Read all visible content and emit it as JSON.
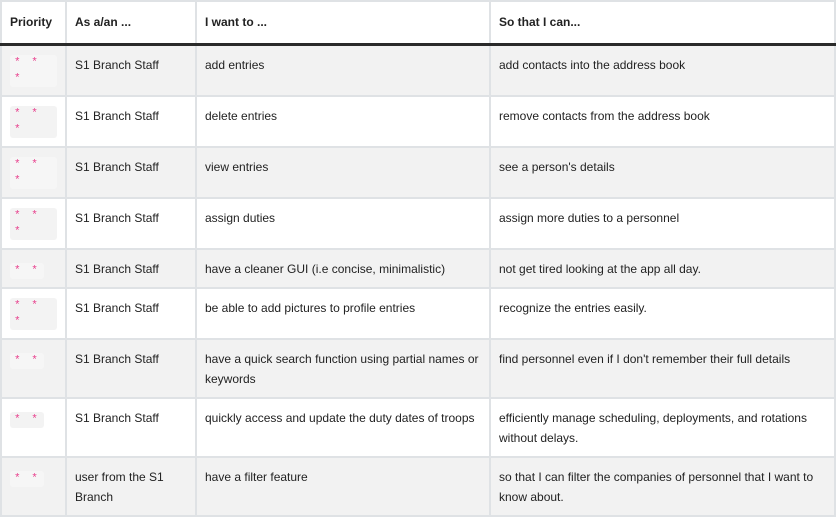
{
  "headers": [
    "Priority",
    "As a/an ...",
    "I want to ...",
    "So that I can..."
  ],
  "rows": [
    {
      "priority": "* * *",
      "role": "S1 Branch Staff",
      "want": "add entries",
      "benefit": "add contacts into the address book"
    },
    {
      "priority": "* * *",
      "role": "S1 Branch Staff",
      "want": "delete entries",
      "benefit": "remove contacts from the address book"
    },
    {
      "priority": "* * *",
      "role": "S1 Branch Staff",
      "want": "view entries",
      "benefit": "see a person's details"
    },
    {
      "priority": "* * *",
      "role": "S1 Branch Staff",
      "want": "assign duties",
      "benefit": "assign more duties to a personnel"
    },
    {
      "priority": "* *",
      "role": "S1 Branch Staff",
      "want": "have a cleaner GUI (i.e concise, minimalistic)",
      "benefit": "not get tired looking at the app all day."
    },
    {
      "priority": "* * *",
      "role": "S1 Branch Staff",
      "want": "be able to add pictures to profile entries",
      "benefit": "recognize the entries easily."
    },
    {
      "priority": "* *",
      "role": "S1 Branch Staff",
      "want": "have a quick search function using partial names or keywords",
      "benefit": "find personnel even if I don't remember their full details"
    },
    {
      "priority": "* *",
      "role": "S1 Branch Staff",
      "want": "quickly access and update the duty dates of troops",
      "benefit": "efficiently manage scheduling, deployments, and rotations without delays."
    },
    {
      "priority": "* *",
      "role": "user from the S1 Branch",
      "want": "have a filter feature",
      "benefit": "so that I can filter the companies of personnel that I want to know about."
    }
  ]
}
